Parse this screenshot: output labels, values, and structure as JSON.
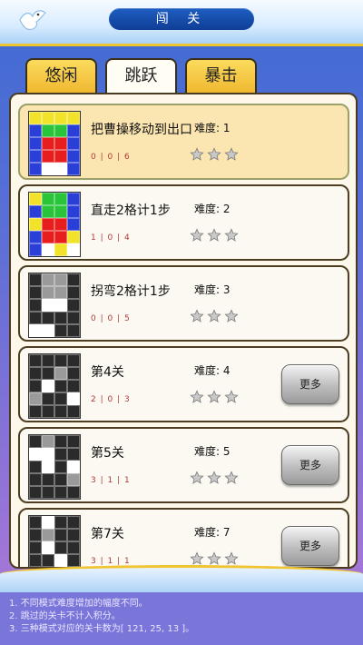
{
  "header": {
    "title": "闯 关",
    "back_icon": "dove-back-icon"
  },
  "tabs": [
    {
      "label": "悠闲",
      "active": false
    },
    {
      "label": "跳跃",
      "active": true
    },
    {
      "label": "暴击",
      "active": false
    }
  ],
  "levels": [
    {
      "name": "把曹操移动到出口",
      "difficulty": "难度: 1",
      "stats": "0 | 0 | 6",
      "stars": 3,
      "more": null,
      "current": true,
      "thumb": [
        "y",
        "y",
        "y",
        "y",
        "b",
        "g",
        "g",
        "b",
        "b",
        "r",
        "r",
        "b",
        "b",
        "r",
        "r",
        "b",
        "b",
        "w",
        "w",
        "b"
      ]
    },
    {
      "name": "直走2格计1步",
      "difficulty": "难度: 2",
      "stats": "1 | 0 | 4",
      "stars": 3,
      "more": null,
      "current": false,
      "thumb": [
        "y",
        "g",
        "g",
        "b",
        "b",
        "g",
        "g",
        "b",
        "y",
        "r",
        "r",
        "b",
        "b",
        "r",
        "r",
        "y",
        "b",
        "w",
        "y",
        "w"
      ]
    },
    {
      "name": "拐弯2格计1步",
      "difficulty": "难度: 3",
      "stats": "0 | 0 | 5",
      "stars": 3,
      "more": null,
      "current": false,
      "thumb": [
        "d",
        "m",
        "m",
        "d",
        "d",
        "m",
        "m",
        "d",
        "d",
        "w",
        "w",
        "d",
        "d",
        "d",
        "d",
        "d",
        "w",
        "w",
        "d",
        "d"
      ]
    },
    {
      "name": "第4关",
      "difficulty": "难度: 4",
      "stats": "2 | 0 | 3",
      "stars": 3,
      "more": "更多",
      "current": false,
      "thumb": [
        "d",
        "d",
        "d",
        "d",
        "d",
        "d",
        "m",
        "d",
        "d",
        "w",
        "d",
        "d",
        "m",
        "d",
        "d",
        "w",
        "d",
        "d",
        "d",
        "d"
      ]
    },
    {
      "name": "第5关",
      "difficulty": "难度: 5",
      "stats": "3 | 1 | 1",
      "stars": 3,
      "more": "更多",
      "current": false,
      "thumb": [
        "d",
        "m",
        "d",
        "d",
        "w",
        "w",
        "d",
        "d",
        "d",
        "w",
        "d",
        "w",
        "d",
        "d",
        "d",
        "m",
        "d",
        "d",
        "d",
        "d"
      ]
    },
    {
      "name": "第7关",
      "difficulty": "难度: 7",
      "stats": "3 | 1 | 1",
      "stars": 3,
      "more": "更多",
      "current": false,
      "thumb": [
        "d",
        "w",
        "d",
        "d",
        "d",
        "m",
        "d",
        "d",
        "d",
        "w",
        "d",
        "d",
        "d",
        "d",
        "w",
        "d",
        "d",
        "d",
        "d",
        "d"
      ]
    }
  ],
  "notes": [
    "1.  不同模式难度增加的幅度不同。",
    "2.  跳过的关卡不计入积分。",
    "3.  三种模式对应的关卡数为[ 121, 25, 13 ]。"
  ],
  "colors": {
    "y": "#f2e32a",
    "b": "#2a3fd8",
    "g": "#2ac43a",
    "r": "#e81e1e",
    "w": "#ffffff",
    "d": "#2b2b2b",
    "m": "#9a9a9a",
    "accent_gold": "#f0c531",
    "title_blue": "#1f5ec2"
  }
}
